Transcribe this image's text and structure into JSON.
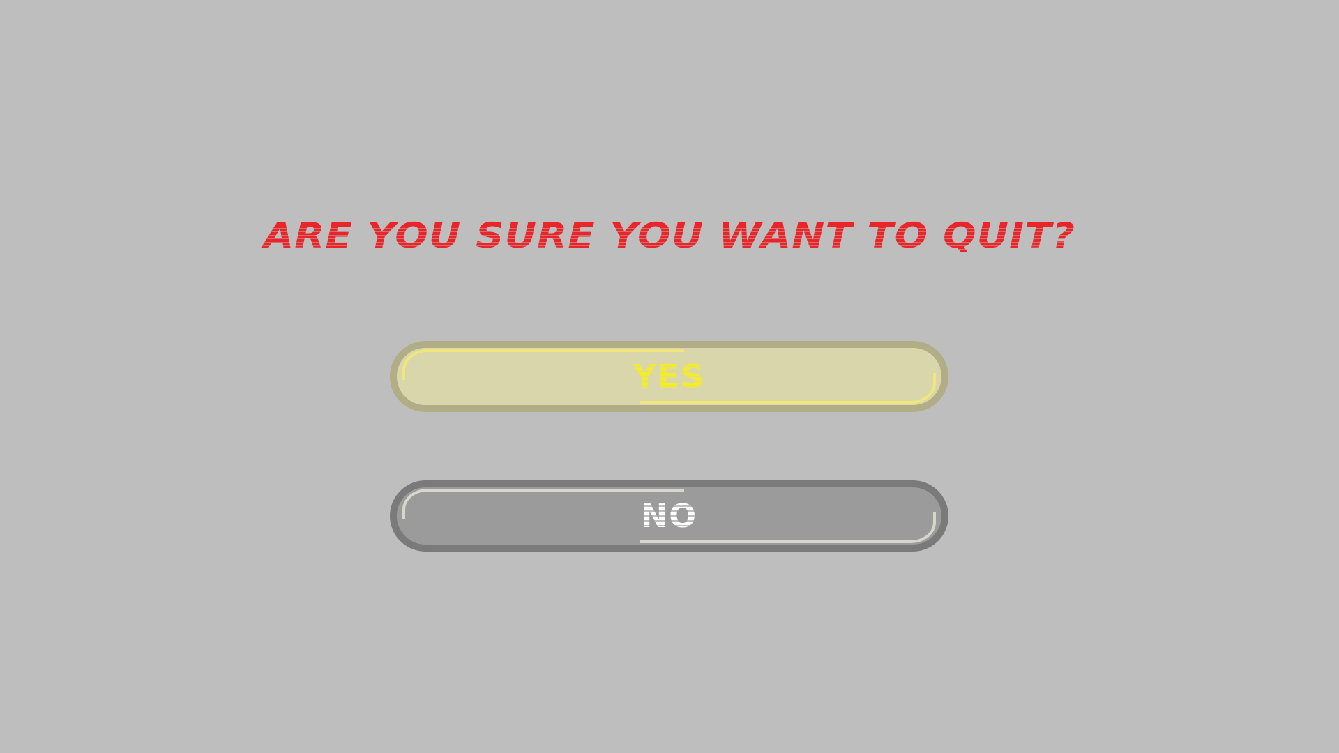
{
  "dialog": {
    "title": "ARE YOU SURE YOU WANT TO QUIT?",
    "yes_label": "YES",
    "no_label": "NO"
  },
  "colors": {
    "background": "#bebebe",
    "title": "#e8262a",
    "yes_fill": "#dad6ab",
    "yes_border": "#b1ad87",
    "yes_text": "#f3ec2a",
    "no_fill": "#9b9b9b",
    "no_border": "#7a7a7a",
    "no_text": "#ffffff"
  },
  "state": {
    "highlighted_button": "yes"
  }
}
